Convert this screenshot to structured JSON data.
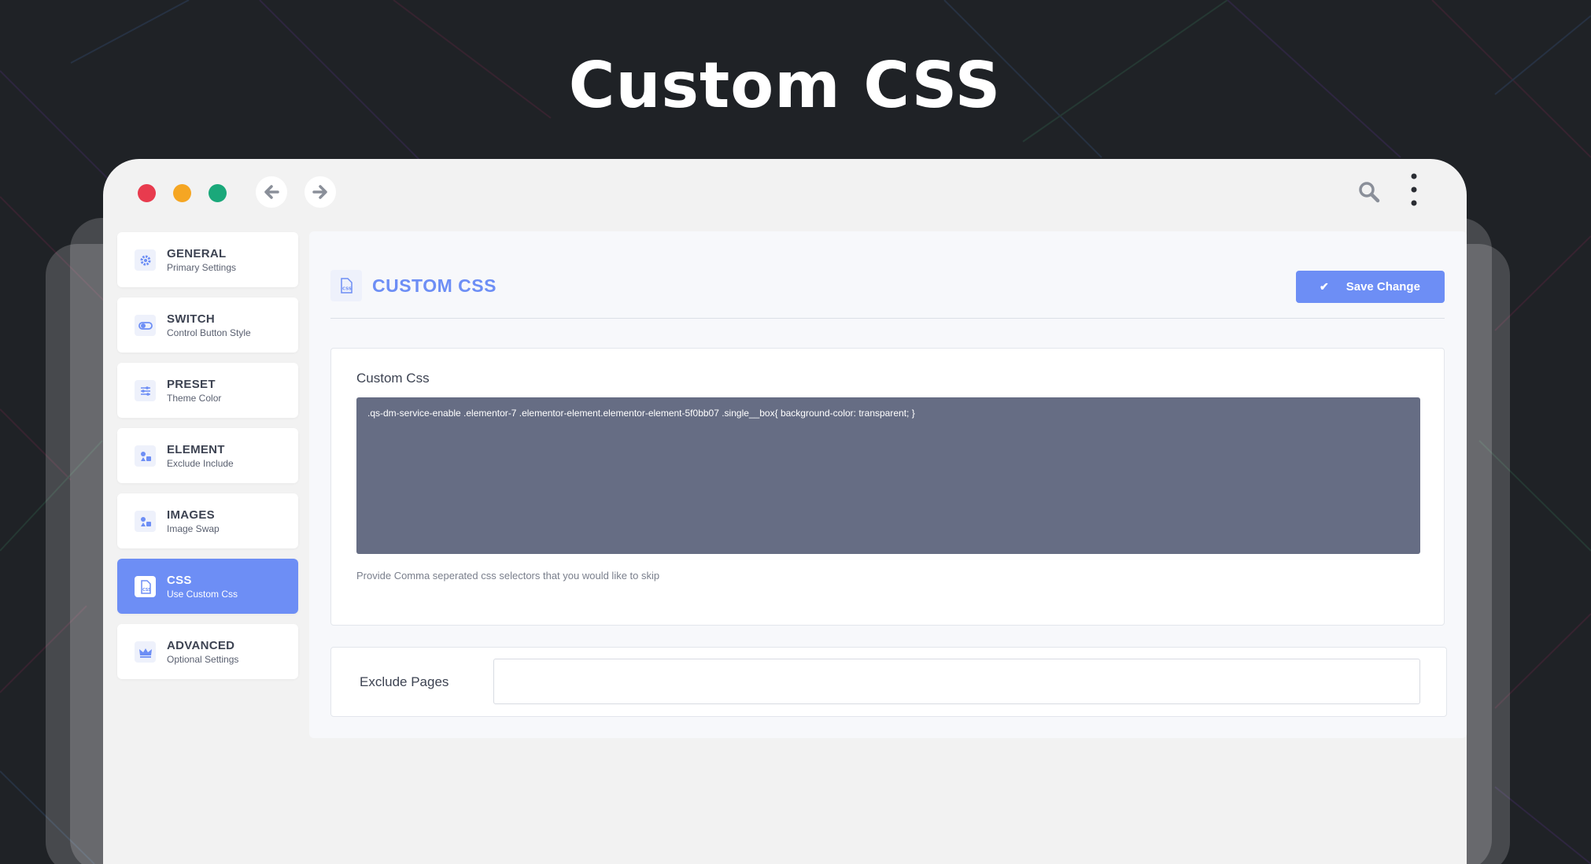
{
  "hero": {
    "title": "Custom CSS"
  },
  "browser": {
    "dots": [
      "#e83b4e",
      "#f5a623",
      "#1aa87a"
    ],
    "nav": {
      "back_icon": "arrow-left-icon",
      "forward_icon": "arrow-right-icon"
    },
    "toolbar": {
      "search_icon": "search-icon",
      "menu_icon": "vertical-dots-icon"
    }
  },
  "sidebar": {
    "items": [
      {
        "title": "GENERAL",
        "subtitle": "Primary Settings",
        "icon": "gear-icon",
        "active": false
      },
      {
        "title": "SWITCH",
        "subtitle": "Control Button Style",
        "icon": "toggle-icon",
        "active": false
      },
      {
        "title": "PRESET",
        "subtitle": "Theme Color",
        "icon": "sliders-icon",
        "active": false
      },
      {
        "title": "ELEMENT",
        "subtitle": "Exclude Include",
        "icon": "shapes-icon",
        "active": false
      },
      {
        "title": "IMAGES",
        "subtitle": "Image Swap",
        "icon": "shapes-icon",
        "active": false
      },
      {
        "title": "CSS",
        "subtitle": "Use Custom Css",
        "icon": "css-file-icon",
        "active": true
      },
      {
        "title": "ADVANCED",
        "subtitle": "Optional Settings",
        "icon": "crown-icon",
        "active": false
      }
    ]
  },
  "main": {
    "header": {
      "title": "CUSTOM CSS",
      "icon": "css-file-icon"
    },
    "save_button": {
      "label": "Save Change",
      "icon": "check-icon"
    },
    "custom_css": {
      "label": "Custom Css",
      "value": ".qs-dm-service-enable .elementor-7 .elementor-element.elementor-element-5f0bb07 .single__box{ background-color: transparent; }",
      "help": "Provide Comma seperated css selectors that you would like to skip"
    },
    "exclude_pages": {
      "label": "Exclude Pages",
      "value": ""
    }
  },
  "colors": {
    "accent": "#6d8ef5",
    "background": "#1f2226",
    "code_bg": "#666d84"
  }
}
